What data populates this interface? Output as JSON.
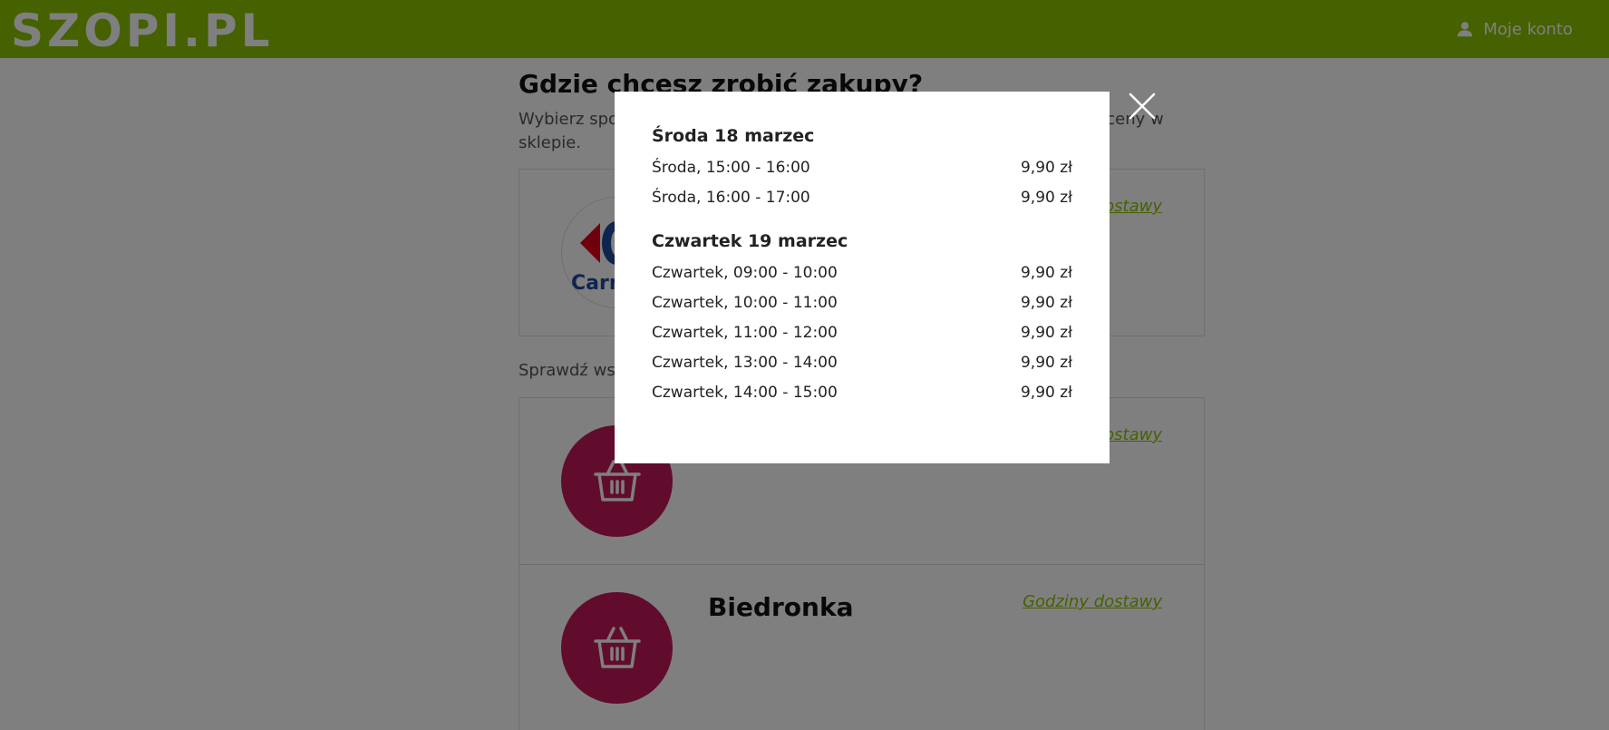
{
  "header": {
    "logo_text": "SZOPI.PL",
    "account_label": "Moje konto",
    "brand_color": "#8bc300",
    "account_icon": "person-icon"
  },
  "main": {
    "title": "Gdzie chcesz zrobić zakupy?",
    "subtitle_visible_start": "Wybierz spo",
    "subtitle_visible_end": "ości i ceny w",
    "subtitle_line2": "sklepie.",
    "check_all_visible": "Sprawdź wsz",
    "stores": [
      {
        "name": "",
        "logo": "carrefour-logo",
        "logo_text": "Carre",
        "hours_link": "ostawy"
      },
      {
        "name": "",
        "logo": "basket-icon",
        "hours_link": "ostawy"
      },
      {
        "name": "Biedronka",
        "logo": "basket-icon",
        "hours_link": "Godziny dostawy"
      }
    ]
  },
  "modal": {
    "days": [
      {
        "title": "Środa 18 marzec",
        "slots": [
          {
            "time": "Środa, 15:00 - 16:00",
            "price": "9,90 zł"
          },
          {
            "time": "Środa, 16:00 - 17:00",
            "price": "9,90 zł"
          }
        ]
      },
      {
        "title": "Czwartek 19 marzec",
        "slots": [
          {
            "time": "Czwartek, 09:00 - 10:00",
            "price": "9,90 zł"
          },
          {
            "time": "Czwartek, 10:00 - 11:00",
            "price": "9,90 zł"
          },
          {
            "time": "Czwartek, 11:00 - 12:00",
            "price": "9,90 zł"
          },
          {
            "time": "Czwartek, 13:00 - 14:00",
            "price": "9,90 zł"
          },
          {
            "time": "Czwartek, 14:00 - 15:00",
            "price": "9,90 zł"
          }
        ]
      }
    ],
    "close_icon": "close-icon"
  }
}
